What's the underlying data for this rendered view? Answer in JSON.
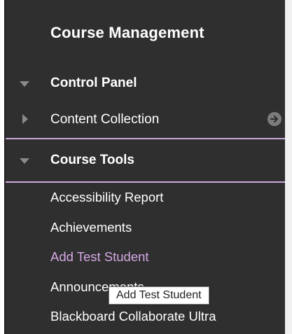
{
  "course_menu": {
    "title": "Course Management",
    "control_panel": {
      "label": "Control Panel",
      "expanded": true,
      "items": [
        {
          "label": "Content Collection",
          "expanded": false
        }
      ]
    },
    "course_tools": {
      "label": "Course Tools",
      "expanded": true,
      "items": [
        {
          "label": "Accessibility Report"
        },
        {
          "label": "Achievements"
        },
        {
          "label": "Add Test Student",
          "hovered": true
        },
        {
          "label": "Announcements"
        },
        {
          "label": "Blackboard Collaborate Ultra"
        }
      ]
    }
  },
  "tooltip": {
    "text": "Add Test Student"
  },
  "icons": {
    "control_panel_toggle": "triangle-down-icon",
    "content_collection_toggle": "triangle-right-icon",
    "content_collection_go": "circle-arrow-right-icon",
    "course_tools_toggle": "triangle-down-icon"
  },
  "colors": {
    "panel_bg": "#2f2f2f",
    "text": "#ffffff",
    "hover_link": "#d4a8e4",
    "divider": "#c8a9d8",
    "toggle_icon": "#8a8a8a"
  }
}
